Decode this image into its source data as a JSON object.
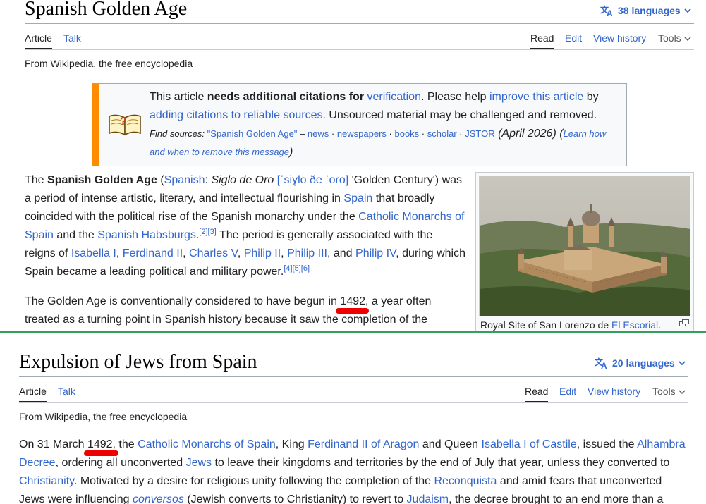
{
  "top": {
    "title": "Spanish Golden Age",
    "languages": "38 languages",
    "tabs": {
      "article": "Article",
      "talk": "Talk",
      "read": "Read",
      "edit": "Edit",
      "history": "View history",
      "tools": "Tools"
    },
    "tagline": "From Wikipedia, the free encyclopedia",
    "notice": {
      "t1": "This article ",
      "bold": "needs additional citations for",
      "sp": " ",
      "link_verification": "verification",
      "t2": ". Please help ",
      "link_improve": "improve this article",
      "t3": " by",
      "link_adding": "adding citations to reliable sources",
      "t4": ". Unsourced material may be challenged and removed.",
      "find_label": "Find sources: ",
      "find_query": "\"Spanish Golden Age\"",
      "dash": " – ",
      "src_news": "news",
      "src_newspapers": "newspapers",
      "src_books": "books",
      "src_scholar": "scholar",
      "src_jstor": "JSTOR",
      "dot": " · ",
      "date": " (April 2026) (",
      "learn": "Learn how and when to remove this message",
      "close": ")"
    },
    "para1": {
      "t1": "The ",
      "bold": "Spanish Golden Age",
      "t2": " (",
      "lang_link": "Spanish",
      "t3": ": ",
      "italic": "Siglo de Oro",
      "sp": " ",
      "ipa": "[ˈsiɣlo ðe ˈoɾo]",
      "t4": " 'Golden Century') was a period of intense artistic, literary, and intellectual flourishing in ",
      "spain": "Spain",
      "t5": " that broadly coincided with the political rise of the Spanish monarchy under the ",
      "cm": "Catholic Monarchs of Spain",
      "t6": " and the ",
      "habs": "Spanish Habsburgs",
      "t7": ".",
      "ref23": "[2][3]",
      "t8": " The period is generally associated with the reigns of ",
      "isabella": "Isabella I",
      "ferdinand": "Ferdinand II",
      "charles": "Charles V",
      "philip2": "Philip II",
      "philip3": "Philip III",
      "philip4": "Philip IV",
      "comma": ", ",
      "and": ", and ",
      "t9": ", during which Spain became a leading political and military power.",
      "ref456": "[4][5][6]"
    },
    "para2": {
      "t1": "The Golden Age is conventionally considered to have begun in ",
      "year": "1492",
      "t2": ", a year often treated as a turning point in Spanish history because it saw the completion of the"
    },
    "infobox": {
      "caption_text": "Royal Site of San Lorenzo de ",
      "caption_link": "El Escorial",
      "caption_end": "."
    }
  },
  "bottom": {
    "title": "Expulsion of Jews from Spain",
    "languages": "20 languages",
    "tabs": {
      "article": "Article",
      "talk": "Talk",
      "read": "Read",
      "edit": "Edit",
      "history": "View history",
      "tools": "Tools"
    },
    "tagline": "From Wikipedia, the free encyclopedia",
    "para": {
      "t1": "On 31 March ",
      "year": "1492",
      "t2": ", the ",
      "cm": "Catholic Monarchs of Spain",
      "t3": ", King ",
      "ferdinand": "Ferdinand II of Aragon",
      "t4": " and Queen ",
      "isabella": "Isabella I of Castile",
      "t5": ", issued the ",
      "alhambra": "Alhambra Decree",
      "t6": ", ordering all unconverted ",
      "jews": "Jews",
      "t7": " to leave their kingdoms and territories by the end of July that year, unless they converted to ",
      "christianity": "Christianity",
      "t8": ". Motivated by a desire for religious unity following the completion of the ",
      "reconquista": "Reconquista",
      "t9": " and amid fears that unconverted Jews were influencing ",
      "conversos": "conversos",
      "t10": " (Jewish converts to Christianity) to revert to ",
      "judaism": "Judaism",
      "t11": ", the decree brought to an end more than a"
    }
  },
  "colors": {
    "link": "#3366cc",
    "notice_accent": "#ff8c00",
    "annotation": "#ee0000",
    "splitter": "#33a05b"
  }
}
